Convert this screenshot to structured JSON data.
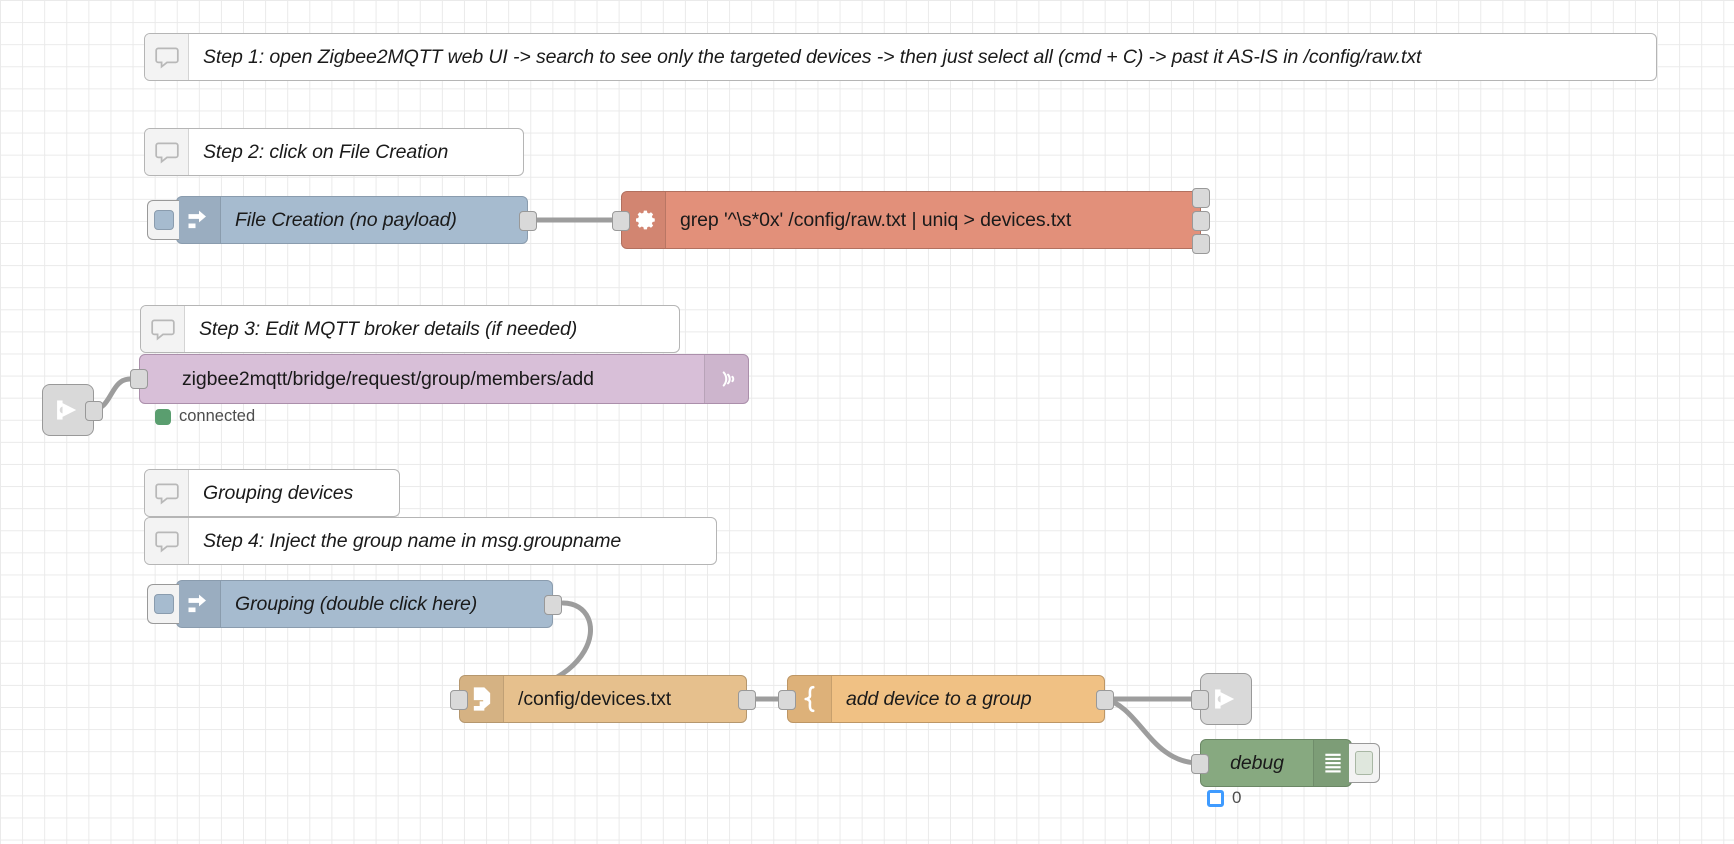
{
  "editor": {
    "app": "Node-RED flow editor",
    "canvas_label": "flow-canvas"
  },
  "comments": [
    {
      "id": "c1",
      "text": "Step 1: open Zigbee2MQTT web UI -> search to see only the targeted devices -> then just select all (cmd + C) -> past it AS-IS in /config/raw.txt",
      "icon": "comment-icon"
    },
    {
      "id": "c2",
      "text": "Step 2: click on File Creation",
      "icon": "comment-icon"
    },
    {
      "id": "c3",
      "text": "Step 3: Edit MQTT broker details (if needed)",
      "icon": "comment-icon"
    },
    {
      "id": "c4",
      "text": "Grouping devices",
      "icon": "comment-icon"
    },
    {
      "id": "c5",
      "text": "Step 4: Inject the group name in msg.groupname",
      "icon": "comment-icon"
    }
  ],
  "nodes": {
    "inject_file_creation": {
      "label": "File Creation (no payload)",
      "type": "inject",
      "icon": "inject-arrow-icon",
      "color": "#a6bbcf"
    },
    "exec_grep": {
      "label": "grep '^\\s*0x' /config/raw.txt | uniq > devices.txt",
      "type": "exec",
      "icon": "gear-icon",
      "color": "#e2907a",
      "outputs": 3
    },
    "mqtt_out": {
      "label": "zigbee2mqtt/bridge/request/group/members/add",
      "type": "mqtt-out",
      "icon": "mqtt-broadcast-icon",
      "color": "#d8bfd8",
      "status": "connected",
      "status_color": "#5a9e6f"
    },
    "inject_grouping": {
      "label": "Grouping (double click here)",
      "type": "inject",
      "icon": "inject-arrow-icon",
      "color": "#a6bbcf"
    },
    "file_devices": {
      "label": "/config/devices.txt",
      "type": "file-in",
      "icon": "file-icon",
      "color": "#e6c08d"
    },
    "function_add_device": {
      "label": "add device to a group",
      "type": "function",
      "icon": "function-brace-icon",
      "color": "#f0c184"
    },
    "debug": {
      "label": "debug",
      "type": "debug",
      "icon": "debug-lines-icon",
      "color": "#87a980",
      "count": "0",
      "badge_color": "#3f9bff"
    },
    "link_in": {
      "label": "",
      "type": "link-in",
      "icon": "link-in-icon",
      "color": "#d9d9d9"
    },
    "link_out": {
      "label": "",
      "type": "link-out",
      "icon": "link-out-icon",
      "color": "#d9d9d9"
    }
  }
}
